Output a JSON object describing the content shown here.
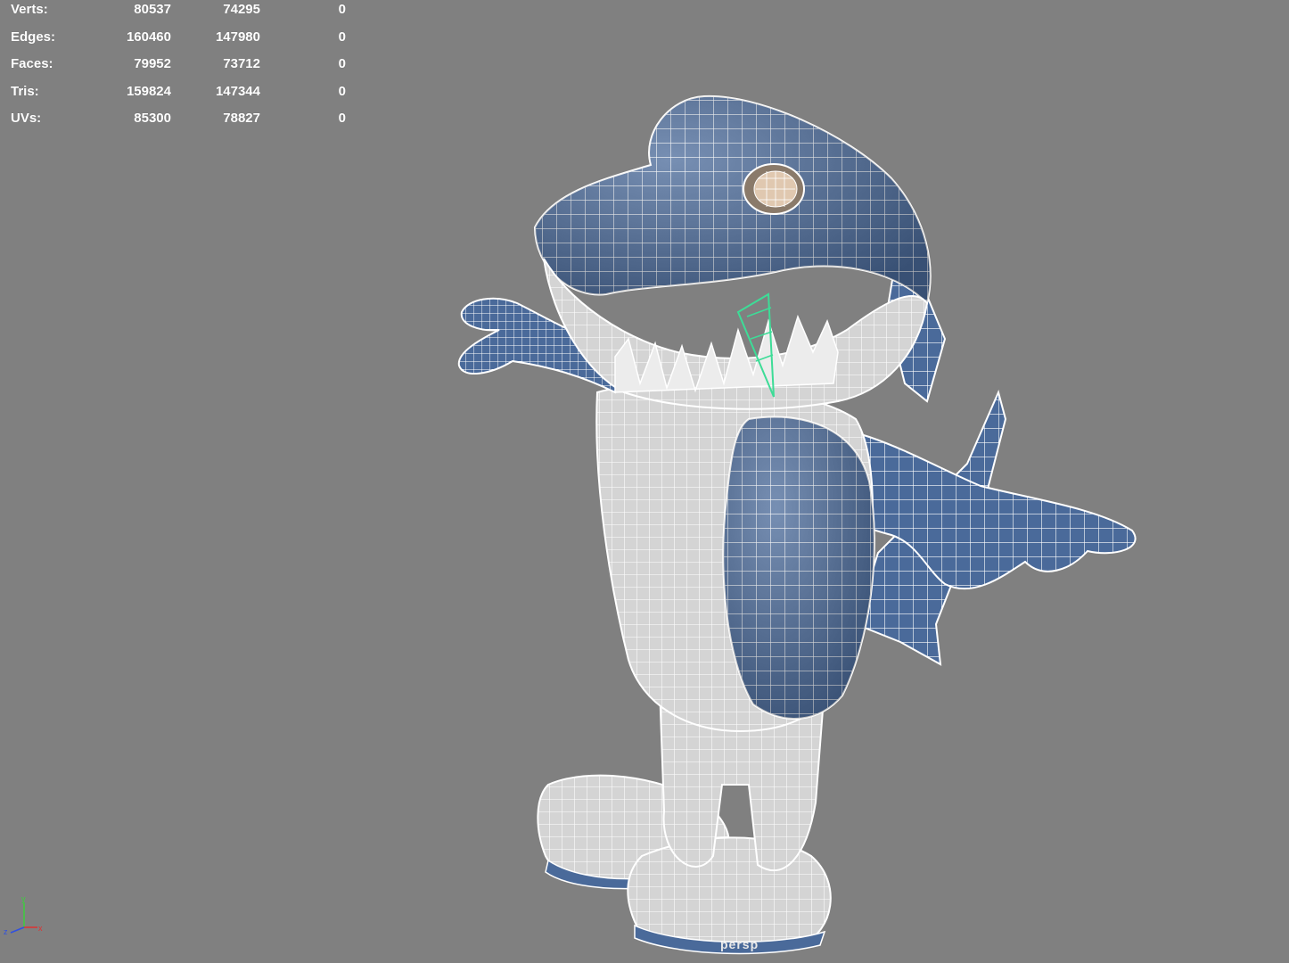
{
  "stats": [
    {
      "label": "Verts:",
      "v1": "80537",
      "v2": "74295",
      "v3": "0"
    },
    {
      "label": "Edges:",
      "v1": "160460",
      "v2": "147980",
      "v3": "0"
    },
    {
      "label": "Faces:",
      "v1": "79952",
      "v2": "73712",
      "v3": "0"
    },
    {
      "label": "Tris:",
      "v1": "159824",
      "v2": "147344",
      "v3": "0"
    },
    {
      "label": "UVs:",
      "v1": "85300",
      "v2": "78827",
      "v3": "0"
    }
  ],
  "viewport": {
    "camera_label": "persp",
    "background": "#808080"
  },
  "axis": {
    "y": "y",
    "z": "z",
    "x": "x"
  },
  "colors": {
    "mesh_blue": "#4a6a9a",
    "mesh_white": "#d8d8d8",
    "wire": "#ffffff",
    "selection": "#3ddc97"
  }
}
